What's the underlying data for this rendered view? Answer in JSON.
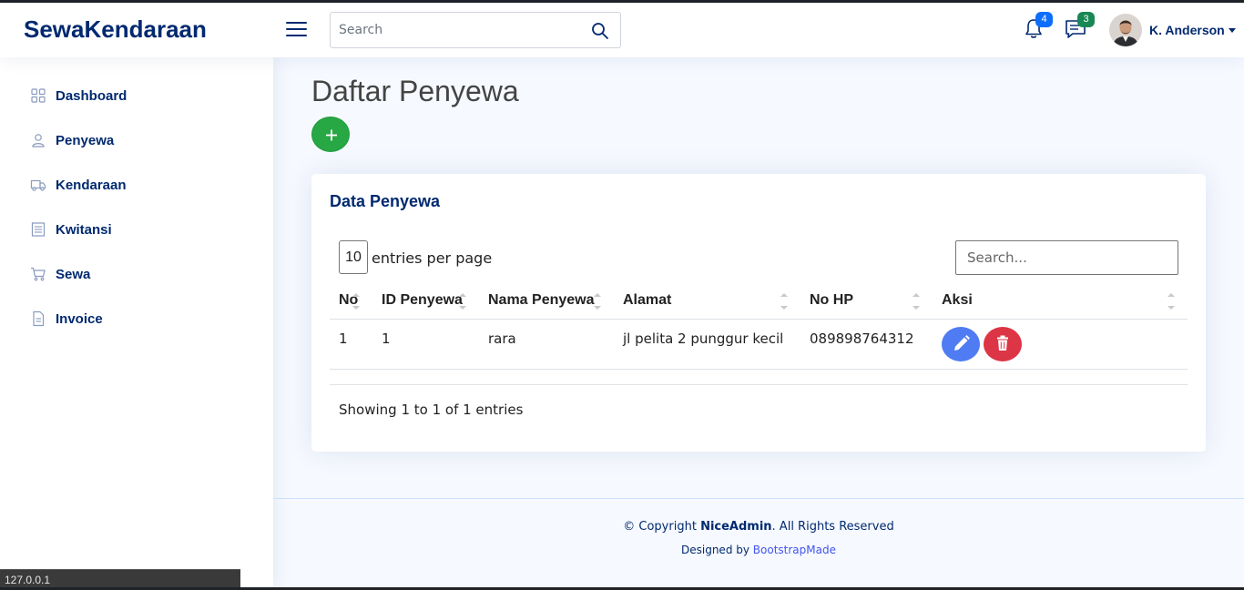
{
  "header": {
    "logo": "SewaKendaraan",
    "search_placeholder": "Search",
    "notifications_count": "4",
    "messages_count": "3",
    "profile_name": "K. Anderson",
    "colors": {
      "brand": "#012970",
      "notif_badge": "#0d6efd",
      "msg_badge": "#198754"
    }
  },
  "sidebar": {
    "items": [
      {
        "label": "Dashboard",
        "icon": "grid-icon"
      },
      {
        "label": "Penyewa",
        "icon": "person-icon"
      },
      {
        "label": "Kendaraan",
        "icon": "truck-icon"
      },
      {
        "label": "Kwitansi",
        "icon": "receipt-icon"
      },
      {
        "label": "Sewa",
        "icon": "cart-icon"
      },
      {
        "label": "Invoice",
        "icon": "file-text-icon"
      }
    ]
  },
  "main": {
    "page_title": "Daftar Penyewa",
    "add_button_icon": "plus-icon",
    "card": {
      "title": "Data Penyewa",
      "per_page_value": "10",
      "per_page_label": "entries per page",
      "search_placeholder": "Search...",
      "columns": [
        "No",
        "ID Penyewa",
        "Nama Penyewa",
        "Alamat",
        "No HP",
        "Aksi"
      ],
      "rows": [
        {
          "no": "1",
          "id": "1",
          "nama": "rara",
          "alamat": "jl pelita 2 punggur kecil",
          "hp": "089898764312"
        }
      ],
      "info": "Showing 1 to 1 of 1 entries",
      "colors": {
        "edit": "#4f7cf2",
        "delete": "#dc3545",
        "add": "#28a745"
      }
    }
  },
  "footer": {
    "copyright_prefix": "© Copyright ",
    "copyright_brand": "NiceAdmin",
    "copyright_suffix": ". All Rights Reserved",
    "designed_prefix": "Designed by ",
    "designed_link": "BootstrapMade"
  },
  "status_bar": {
    "url": "127.0.0.1"
  }
}
